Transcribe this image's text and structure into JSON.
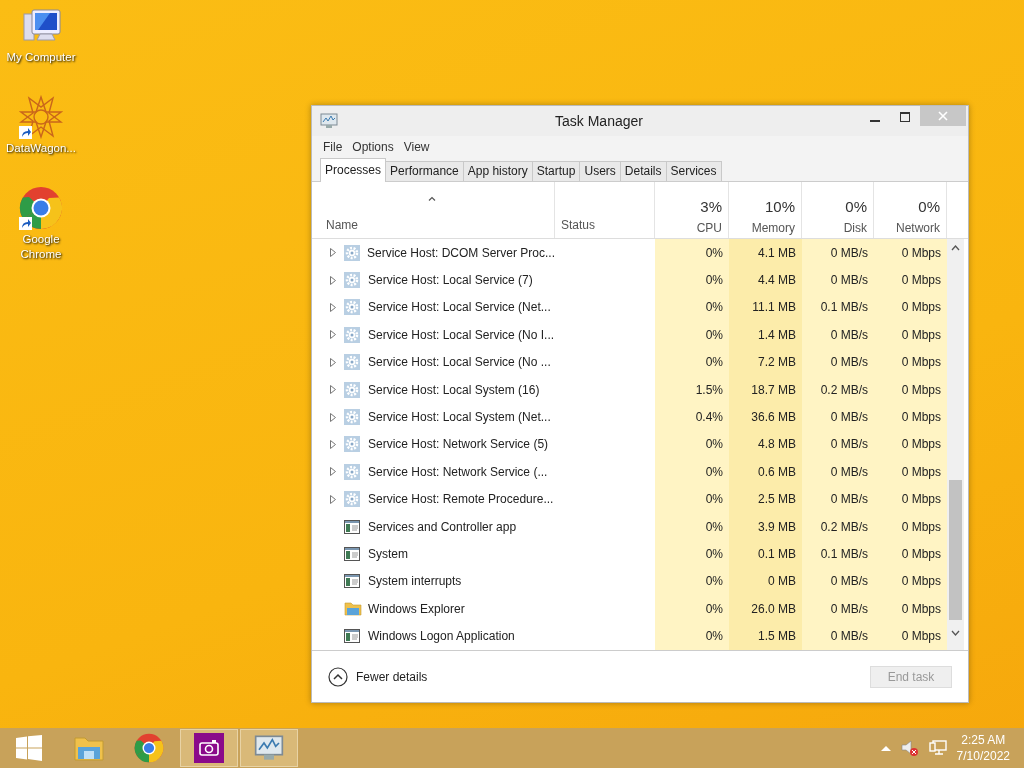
{
  "desktop_icons": [
    {
      "kind": "computer",
      "label": "My Computer",
      "shortcut": false
    },
    {
      "kind": "star",
      "label": "DataWagon...",
      "shortcut": true
    },
    {
      "kind": "chrome",
      "label": "Google Chrome",
      "shortcut": true
    }
  ],
  "window": {
    "title": "Task Manager",
    "menu": [
      "File",
      "Options",
      "View"
    ],
    "tabs": [
      {
        "label": "Processes",
        "selected": true
      },
      {
        "label": "Performance",
        "selected": false
      },
      {
        "label": "App history",
        "selected": false
      },
      {
        "label": "Startup",
        "selected": false
      },
      {
        "label": "Users",
        "selected": false
      },
      {
        "label": "Details",
        "selected": false
      },
      {
        "label": "Services",
        "selected": false
      }
    ],
    "columns": [
      {
        "kind": "name",
        "label": "Name"
      },
      {
        "kind": "status",
        "label": "Status"
      },
      {
        "kind": "usage",
        "summary": "3%",
        "label": "CPU"
      },
      {
        "kind": "usage",
        "summary": "10%",
        "label": "Memory"
      },
      {
        "kind": "usage",
        "summary": "0%",
        "label": "Disk"
      },
      {
        "kind": "usage",
        "summary": "0%",
        "label": "Network"
      }
    ],
    "rows": [
      {
        "kind": "service",
        "name": "Service Host: DCOM Server Proc...",
        "cpu": "0%",
        "memory": "4.1 MB",
        "disk": "0 MB/s",
        "network": "0 Mbps"
      },
      {
        "kind": "service",
        "name": "Service Host: Local Service (7)",
        "cpu": "0%",
        "memory": "4.4 MB",
        "disk": "0 MB/s",
        "network": "0 Mbps"
      },
      {
        "kind": "service",
        "name": "Service Host: Local Service (Net...",
        "cpu": "0%",
        "memory": "11.1 MB",
        "disk": "0.1 MB/s",
        "network": "0 Mbps"
      },
      {
        "kind": "service",
        "name": "Service Host: Local Service (No I...",
        "cpu": "0%",
        "memory": "1.4 MB",
        "disk": "0 MB/s",
        "network": "0 Mbps"
      },
      {
        "kind": "service",
        "name": "Service Host: Local Service (No ...",
        "cpu": "0%",
        "memory": "7.2 MB",
        "disk": "0 MB/s",
        "network": "0 Mbps"
      },
      {
        "kind": "service",
        "name": "Service Host: Local System (16)",
        "cpu": "1.5%",
        "memory": "18.7 MB",
        "disk": "0.2 MB/s",
        "network": "0 Mbps"
      },
      {
        "kind": "service",
        "name": "Service Host: Local System (Net...",
        "cpu": "0.4%",
        "memory": "36.6 MB",
        "disk": "0 MB/s",
        "network": "0 Mbps"
      },
      {
        "kind": "service",
        "name": "Service Host: Network Service (5)",
        "cpu": "0%",
        "memory": "4.8 MB",
        "disk": "0 MB/s",
        "network": "0 Mbps"
      },
      {
        "kind": "service",
        "name": "Service Host: Network Service (...",
        "cpu": "0%",
        "memory": "0.6 MB",
        "disk": "0 MB/s",
        "network": "0 Mbps"
      },
      {
        "kind": "service",
        "name": "Service Host: Remote Procedure...",
        "cpu": "0%",
        "memory": "2.5 MB",
        "disk": "0 MB/s",
        "network": "0 Mbps"
      },
      {
        "kind": "app",
        "name": "Services and Controller app",
        "cpu": "0%",
        "memory": "3.9 MB",
        "disk": "0.2 MB/s",
        "network": "0 Mbps"
      },
      {
        "kind": "app",
        "name": "System",
        "cpu": "0%",
        "memory": "0.1 MB",
        "disk": "0.1 MB/s",
        "network": "0 Mbps"
      },
      {
        "kind": "app",
        "name": "System interrupts",
        "cpu": "0%",
        "memory": "0 MB",
        "disk": "0 MB/s",
        "network": "0 Mbps"
      },
      {
        "kind": "folder",
        "name": "Windows Explorer",
        "cpu": "0%",
        "memory": "26.0 MB",
        "disk": "0 MB/s",
        "network": "0 Mbps"
      },
      {
        "kind": "app",
        "name": "Windows Logon Application",
        "cpu": "0%",
        "memory": "1.5 MB",
        "disk": "0 MB/s",
        "network": "0 Mbps"
      }
    ],
    "fewer_details": "Fewer details",
    "end_task": {
      "label": "End task",
      "disabled": true
    }
  },
  "taskbar": {
    "apps": [
      {
        "kind": "start",
        "running": false
      },
      {
        "kind": "explorer",
        "running": false
      },
      {
        "kind": "chrome",
        "running": false
      },
      {
        "kind": "camera",
        "running": true
      },
      {
        "kind": "taskmgr",
        "running": true
      }
    ],
    "clock": {
      "time": "2:25 AM",
      "date": "7/10/2022"
    }
  }
}
